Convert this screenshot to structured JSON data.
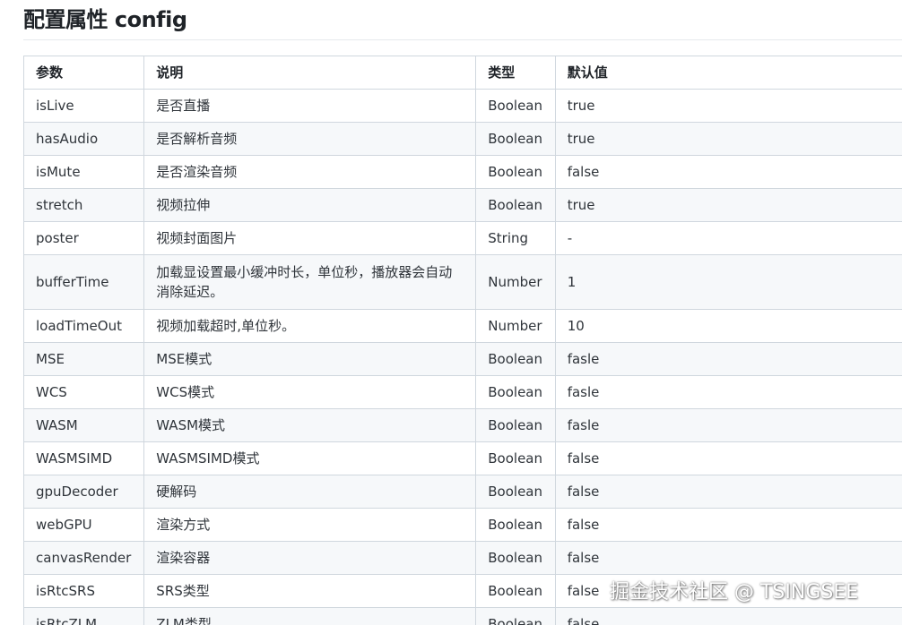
{
  "title": "配置属性 config",
  "table": {
    "headers": [
      "参数",
      "说明",
      "类型",
      "默认值"
    ],
    "rows": [
      {
        "param": "isLive",
        "desc": "是否直播",
        "type": "Boolean",
        "default": "true"
      },
      {
        "param": "hasAudio",
        "desc": "是否解析音频",
        "type": "Boolean",
        "default": "true"
      },
      {
        "param": "isMute",
        "desc": "是否渲染音频",
        "type": "Boolean",
        "default": "false"
      },
      {
        "param": "stretch",
        "desc": "视频拉伸",
        "type": "Boolean",
        "default": "true"
      },
      {
        "param": "poster",
        "desc": "视频封面图片",
        "type": "String",
        "default": "-"
      },
      {
        "param": "bufferTime",
        "desc": "加载显设置最小缓冲时长，单位秒，播放器会自动消除延迟。",
        "type": "Number",
        "default": "1"
      },
      {
        "param": "loadTimeOut",
        "desc": "视频加载超时,单位秒。",
        "type": "Number",
        "default": "10"
      },
      {
        "param": "MSE",
        "desc": "MSE模式",
        "type": "Boolean",
        "default": "fasle"
      },
      {
        "param": "WCS",
        "desc": "WCS模式",
        "type": "Boolean",
        "default": "fasle"
      },
      {
        "param": "WASM",
        "desc": "WASM模式",
        "type": "Boolean",
        "default": "fasle"
      },
      {
        "param": "WASMSIMD",
        "desc": "WASMSIMD模式",
        "type": "Boolean",
        "default": "false"
      },
      {
        "param": "gpuDecoder",
        "desc": "硬解码",
        "type": "Boolean",
        "default": "false"
      },
      {
        "param": "webGPU",
        "desc": "渲染方式",
        "type": "Boolean",
        "default": "false"
      },
      {
        "param": "canvasRender",
        "desc": "渲染容器",
        "type": "Boolean",
        "default": "false"
      },
      {
        "param": "isRtcSRS",
        "desc": "SRS类型",
        "type": "Boolean",
        "default": "false"
      },
      {
        "param": "isRtcZLM",
        "desc": "ZLM类型",
        "type": "Boolean",
        "default": "false"
      }
    ]
  },
  "watermark": "掘金技术社区 @ TSINGSEE"
}
